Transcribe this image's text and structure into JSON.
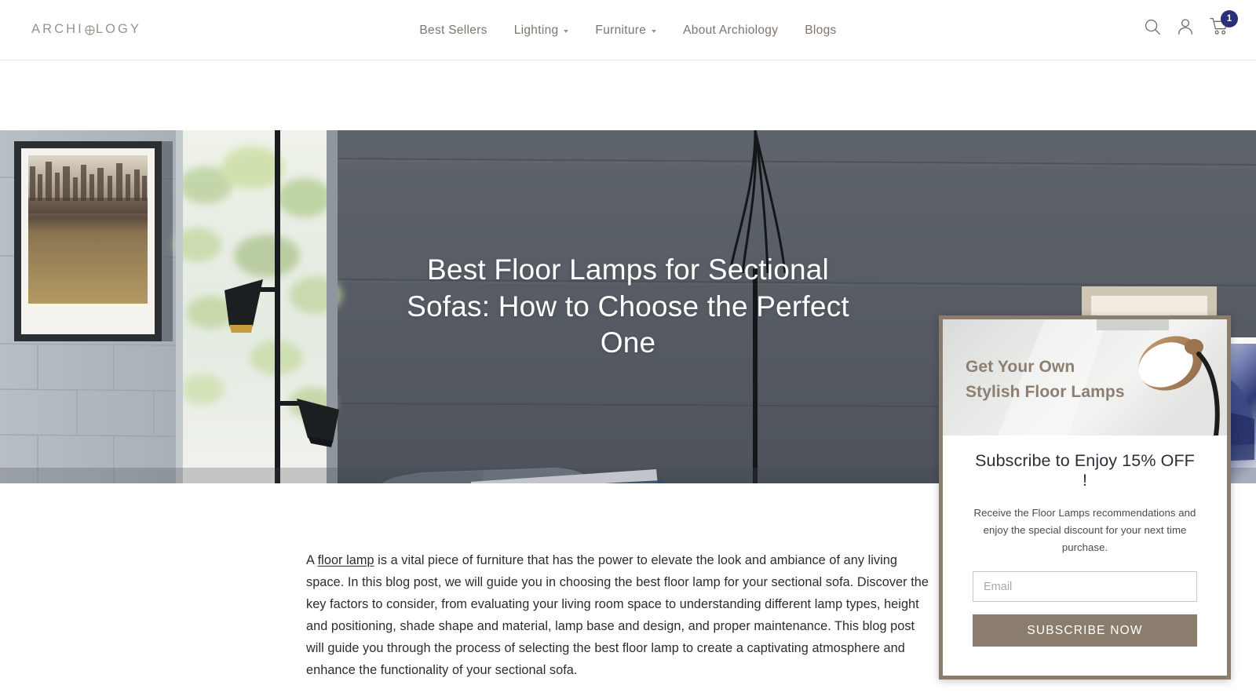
{
  "header": {
    "logo_text_left": "ARCHI",
    "logo_icon": "circled-plus-icon",
    "logo_text_right": "LOGY",
    "nav": [
      {
        "label": "Best Sellers",
        "has_dropdown": false
      },
      {
        "label": "Lighting",
        "has_dropdown": true
      },
      {
        "label": "Furniture",
        "has_dropdown": true
      },
      {
        "label": "About Archiology",
        "has_dropdown": false
      },
      {
        "label": "Blogs",
        "has_dropdown": false
      }
    ],
    "actions": {
      "search_icon": "search-icon",
      "account_icon": "user-account-icon",
      "cart_icon": "shopping-cart-icon",
      "cart_count": "1",
      "cart_badge_color": "#2b2f77"
    }
  },
  "hero": {
    "title": "Best Floor Lamps for Sectional Sofas: How to Choose the Perfect One",
    "image_description": "living room with gray shiplap wall, framed art, black floor lamps, gray armchair with indigo striped pillow, plant in white pitcher"
  },
  "article": {
    "paragraph_lead": "A ",
    "link_text": "floor lamp",
    "paragraph_rest": " is a vital piece of furniture that has the power to elevate the look and ambiance of any living space. In this blog post, we will guide you in choosing the best floor lamp for your sectional sofa. Discover the key factors to consider, from evaluating your living room space to understanding different lamp types, height and positioning, shade shape and material, lamp base and design, and proper maintenance. This blog post will guide you through the process of selecting the best floor lamp to create a captivating atmosphere and enhance the functionality of your sectional sofa."
  },
  "popup": {
    "banner_line1": "Get Your Own",
    "banner_line2": "Stylish Floor Lamps",
    "banner_image_description": "wooden dome floor lamp shade against light gray wall",
    "heading": "Subscribe to Enjoy 15% OFF !",
    "subtext": "Receive the Floor Lamps recommendations and enjoy the special discount for your next time purchase.",
    "email_placeholder": "Email",
    "email_value": "",
    "button_label": "SUBSCRIBE NOW",
    "accent_color": "#8b7d6d",
    "banner_text_color": "#8c7f72"
  }
}
